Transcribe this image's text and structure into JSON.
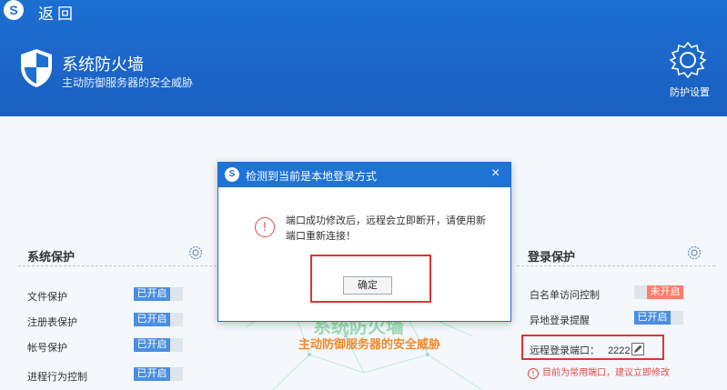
{
  "topbar": {
    "back_label": "返回",
    "logo_letter": "S"
  },
  "header": {
    "title": "系统防火墙",
    "subtitle": "主动防御服务器的安全威胁",
    "settings_label": "防护设置"
  },
  "left_panel": {
    "title": "系统保护",
    "items": [
      {
        "label": "文件保护",
        "status": "已开启"
      },
      {
        "label": "注册表保护",
        "status": "已开启"
      },
      {
        "label": "帐号保护",
        "status": "已开启"
      },
      {
        "label": "进程行为控制",
        "status": "已开启"
      }
    ]
  },
  "center": {
    "watermark_title": "系统防火墙",
    "watermark_subtitle": "主动防御服务器的安全威胁"
  },
  "right_panel": {
    "title": "登录保护",
    "items": [
      {
        "label": "白名单访问控制",
        "status": "未开启"
      },
      {
        "label": "异地登录提醒",
        "status": "已开启"
      }
    ],
    "port_label": "远程登录端口：",
    "port_value": "2222",
    "port_warning": "目前为常用端口，建议立即修改"
  },
  "dialog": {
    "title": "检测到当前是本地登录方式",
    "close": "×",
    "message": "端口成功修改后，远程会立即断开，请使用新端口重新连接！",
    "confirm_label": "确定"
  },
  "colors": {
    "header_blue": "#1d6fd2",
    "on_blue": "#4a8edf",
    "off_red": "#ff7b6b",
    "highlight_red": "#dd3333"
  }
}
